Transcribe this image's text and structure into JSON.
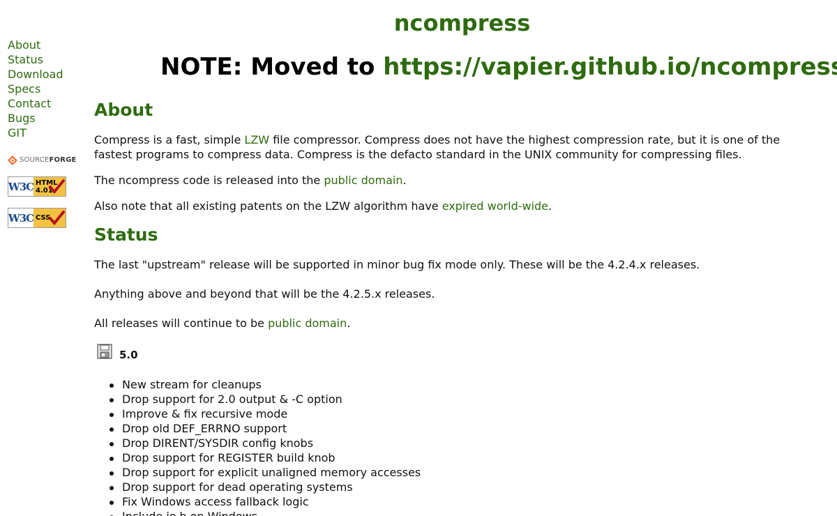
{
  "sidebar": {
    "nav": [
      {
        "label": "About"
      },
      {
        "label": "Status"
      },
      {
        "label": "Download"
      },
      {
        "label": "Specs"
      },
      {
        "label": "Contact"
      },
      {
        "label": "Bugs"
      },
      {
        "label": "GIT"
      }
    ],
    "sourceforge": {
      "source": "SOURCE",
      "forge": "FORGE"
    },
    "badges": [
      {
        "mark": "W3C",
        "line1": "HTML",
        "line2": "4.01"
      },
      {
        "mark": "W3C",
        "line1": "CSS",
        "line2": ""
      }
    ]
  },
  "header": {
    "title": "ncompress",
    "note_prefix": "NOTE: Moved to ",
    "note_link": "https://vapier.github.io/ncompress/",
    "note_suffix": "."
  },
  "about": {
    "heading": "About",
    "p1_a": "Compress is a fast, simple ",
    "p1_link": "LZW",
    "p1_b": " file compressor. Compress does not have the highest compression rate, but it is one of the fastest programs to compress data. Compress is the defacto standard in the UNIX community for compressing files.",
    "p2_a": "The ncompress code is released into the ",
    "p2_link": "public domain",
    "p2_b": ".",
    "p3_a": "Also note that all existing patents on the LZW algorithm have ",
    "p3_link": "expired world-wide",
    "p3_b": "."
  },
  "status": {
    "heading": "Status",
    "p1": "The last \"upstream\" release will be supported in minor bug fix mode only. These will be the 4.2.4.x releases.",
    "p2": "Anything above and beyond that will be the 4.2.5.x releases.",
    "p3_a": "All releases will continue to be ",
    "p3_link": "public domain",
    "p3_b": "."
  },
  "release": {
    "icon": "floppy-disk-icon",
    "version": "5.0",
    "changes": [
      "New stream for cleanups",
      "Drop support for 2.0 output & -C option",
      "Improve & fix recursive mode",
      "Drop old DEF_ERRNO support",
      "Drop DIRENT/SYSDIR config knobs",
      "Drop support for REGISTER build knob",
      "Drop support for explicit unaligned memory accesses",
      "Drop support for dead operating systems",
      "Fix Windows access fallback logic",
      "Include io.h on Windows"
    ]
  },
  "colors": {
    "link_green": "#2e6b0f",
    "text": "#111111",
    "badge_yellow": "#f3c243",
    "w3c_blue": "#1a4b8c"
  }
}
